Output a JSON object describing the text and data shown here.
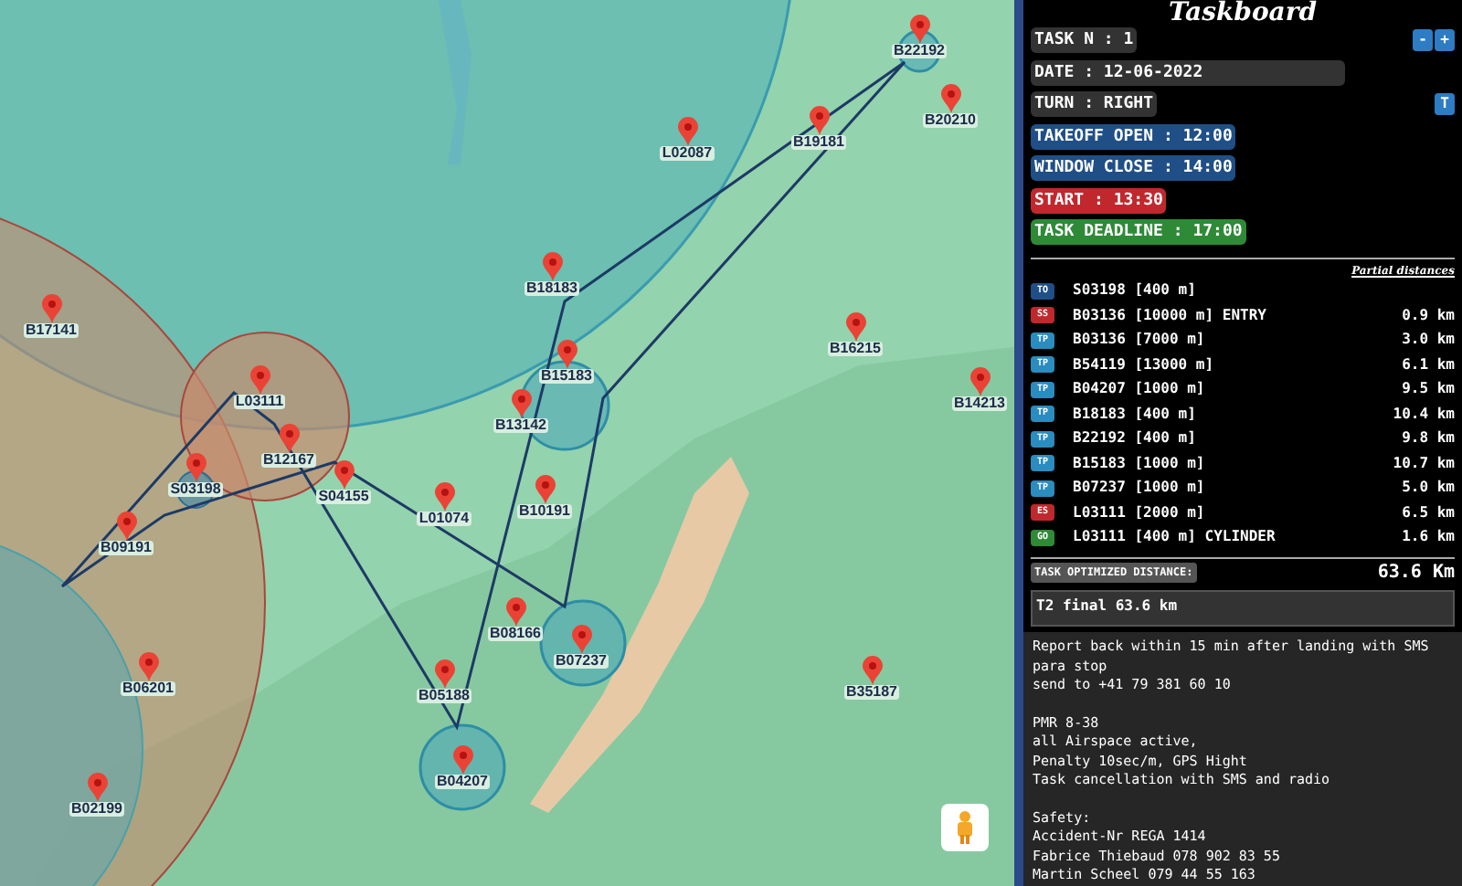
{
  "map": {
    "markers": [
      "B22192",
      "B20210",
      "L02087",
      "B19181",
      "B18183",
      "B17141",
      "B16215",
      "B15183",
      "L03111",
      "B14213",
      "B13142",
      "B12167",
      "S03198",
      "S04155",
      "L01074",
      "B10191",
      "B09191",
      "B08166",
      "B07237",
      "B06201",
      "B05188",
      "B35187",
      "B04207",
      "B02199"
    ]
  },
  "taskboard": {
    "title": "Taskboard",
    "fields": [
      {
        "text": "TASK N : 1",
        "kind": "neutral"
      },
      {
        "text": "DATE : 12-06-2022",
        "kind": "input"
      },
      {
        "text": "TURN : RIGHT",
        "kind": "neutral"
      },
      {
        "text": "TAKEOFF OPEN : 12:00",
        "kind": "info"
      },
      {
        "text": "WINDOW CLOSE : 14:00",
        "kind": "info"
      },
      {
        "text": "START : 13:30",
        "kind": "danger"
      },
      {
        "text": "TASK DEADLINE : 17:00",
        "kind": "success"
      }
    ],
    "task_buttons": [
      "-",
      "+"
    ],
    "turn_button": "T",
    "partial_heading": "Partial distances",
    "waypoints": [
      {
        "badge": "TO",
        "kind": "takeoff",
        "name": "S03198 [400 m]"
      },
      {
        "badge": "SS",
        "kind": "start",
        "name": "B03136 [10000 m] ENTRY",
        "distance": "0.9 km"
      },
      {
        "badge": "TP",
        "kind": "turnpoint",
        "name": "B03136 [7000 m]",
        "distance": "3.0 km"
      },
      {
        "badge": "TP",
        "kind": "turnpoint",
        "name": "B54119 [13000 m]",
        "distance": "6.1 km"
      },
      {
        "badge": "TP",
        "kind": "turnpoint",
        "name": "B04207 [1000 m]",
        "distance": "9.5 km"
      },
      {
        "badge": "TP",
        "kind": "turnpoint",
        "name": "B18183 [400 m]",
        "distance": "10.4 km"
      },
      {
        "badge": "TP",
        "kind": "turnpoint",
        "name": "B22192 [400 m]",
        "distance": "9.8 km"
      },
      {
        "badge": "TP",
        "kind": "turnpoint",
        "name": "B15183 [1000 m]",
        "distance": "10.7 km"
      },
      {
        "badge": "TP",
        "kind": "turnpoint",
        "name": "B07237 [1000 m]",
        "distance": "5.0 km"
      },
      {
        "badge": "ES",
        "kind": "start",
        "name": "L03111 [2000 m]",
        "distance": "6.5 km"
      },
      {
        "badge": "GO",
        "kind": "goal",
        "name": "L03111 [400 m] CYLINDER",
        "distance": "1.6 km"
      }
    ],
    "optimized_label": "TASK OPTIMIZED DISTANCE:",
    "optimized_value": "63.6 Km",
    "comment": "T2 final 63.6 km",
    "notes": [
      [
        "Report back within 15 min after landing with SMS",
        "para stop",
        "send to +41 79 381 60 10"
      ],
      [
        "PMR 8-38",
        "all Airspace active,",
        "Penalty 10sec/m, GPS Hight",
        "Task cancellation with SMS and radio"
      ],
      [
        "Safety:",
        "Accident-Nr REGA 1414",
        "Fabrice Thiebaud 078 902 83 55",
        "Martin Scheel 079 44 55 163"
      ]
    ]
  }
}
